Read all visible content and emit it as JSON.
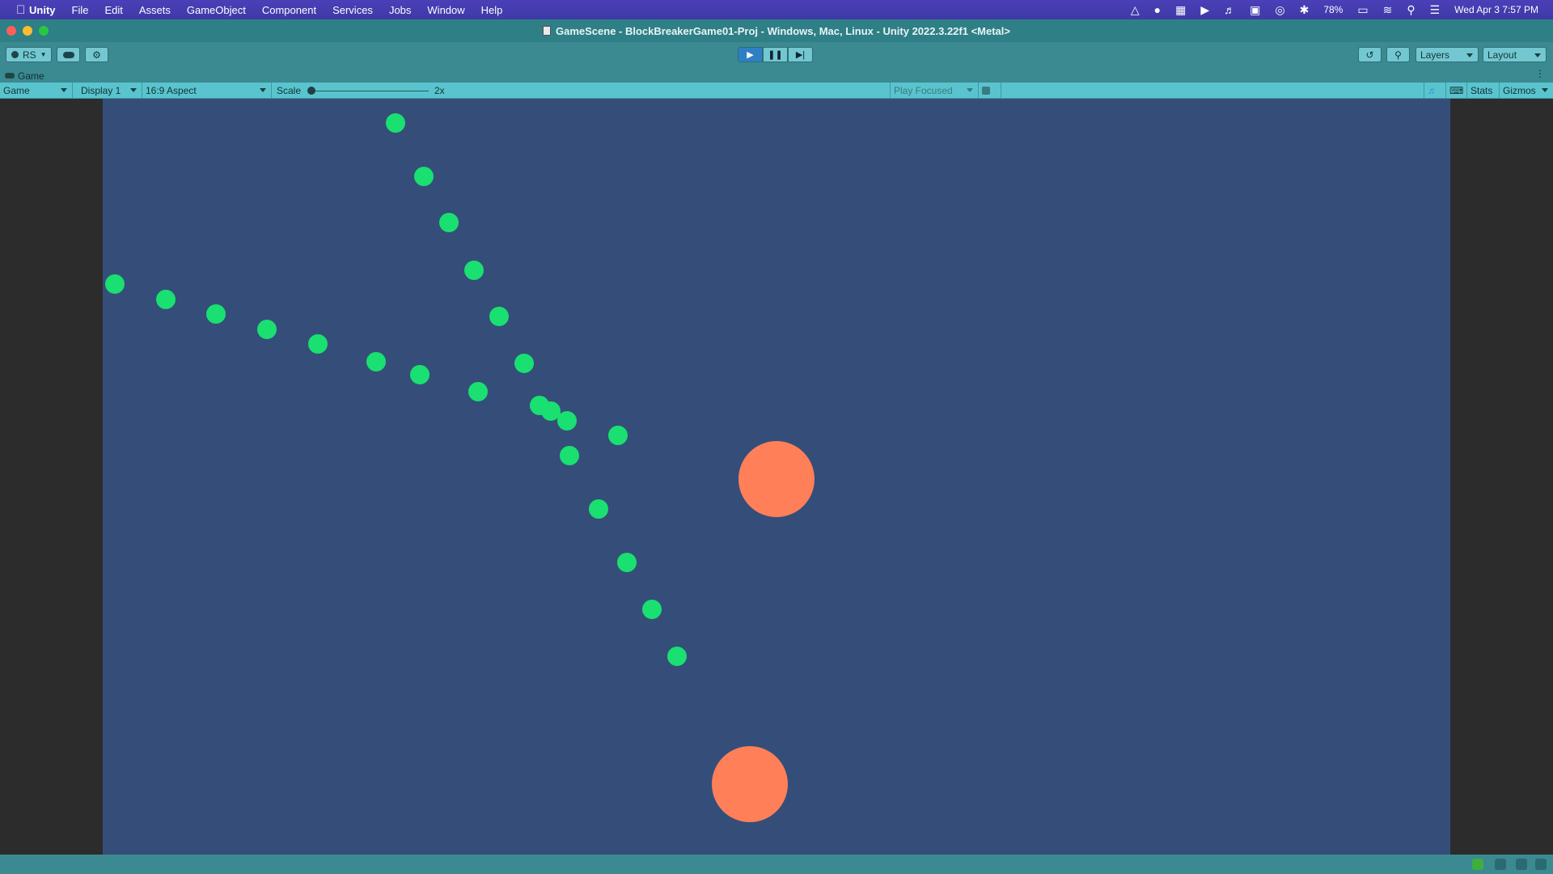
{
  "menubar": {
    "app_name": "Unity",
    "items": [
      "File",
      "Edit",
      "Assets",
      "GameObject",
      "Component",
      "Services",
      "Jobs",
      "Window",
      "Help"
    ],
    "battery": "78%",
    "datetime": "Wed Apr 3  7:57 PM"
  },
  "window": {
    "title": "GameScene - BlockBreakerGame01-Proj - Windows, Mac, Linux - Unity 2022.3.22f1 <Metal>"
  },
  "toolbar": {
    "account_label": "RS",
    "layers_label": "Layers",
    "layout_label": "Layout",
    "play_state": "playing"
  },
  "tab": {
    "label": "Game"
  },
  "gamebar": {
    "view_select": "Game",
    "display_select": "Display 1",
    "aspect_select": "16:9 Aspect",
    "scale_label": "Scale",
    "scale_value": "2x",
    "play_mode_select": "Play Focused",
    "stats_label": "Stats",
    "gizmos_label": "Gizmos"
  },
  "colors": {
    "game_background": "#344e79",
    "green_ball": "#19e070",
    "orange_ball": "#ff7f59",
    "menubar": "#3f3aa6",
    "window_chrome": "#3b8a91"
  }
}
